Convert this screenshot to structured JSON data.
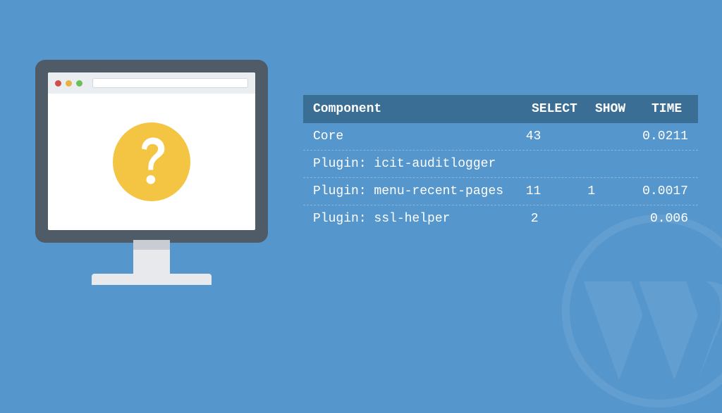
{
  "table": {
    "headers": {
      "component": "Component",
      "select": "SELECT",
      "show": "SHOW",
      "time": "TIME"
    },
    "rows": [
      {
        "component": "Core",
        "select": "43",
        "show": "",
        "time": "0.0211"
      },
      {
        "component": "Plugin: icit-auditlogger",
        "select": "",
        "show": "",
        "time": ""
      },
      {
        "component": "Plugin: menu-recent-pages",
        "select": "11",
        "show": "1",
        "time": "0.0017"
      },
      {
        "component": "Plugin: ssl-helper",
        "select": "2",
        "show": "",
        "time": "0.006"
      }
    ]
  }
}
